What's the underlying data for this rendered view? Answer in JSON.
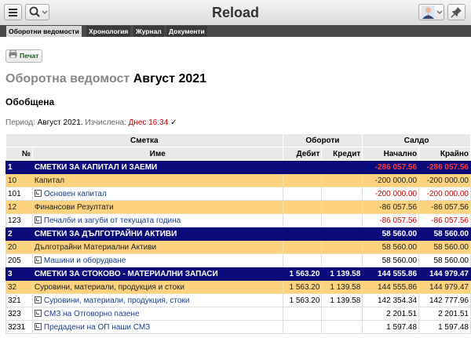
{
  "app": {
    "title": "Reload"
  },
  "tabs": [
    {
      "label": "Оборотни ведомости",
      "active": true
    },
    {
      "label": "Хронология",
      "active": false
    },
    {
      "label": "Журнал",
      "active": false
    },
    {
      "label": "Документи",
      "active": false
    }
  ],
  "toolbar": {
    "print_label": "Печат"
  },
  "report": {
    "title_prefix": "Оборотна ведомост",
    "title_period": "Август 2021",
    "subtitle": "Обобщена",
    "period_label": "Период:",
    "period_value": "Август 2021.",
    "computed_label": "Изчислена:",
    "computed_value": "Днес 16:34",
    "check_mark": "✓"
  },
  "table": {
    "headers": {
      "account": "Сметка",
      "turnover": "Обороти",
      "balance": "Салдо",
      "no": "№",
      "name": "Име",
      "debit": "Дебит",
      "credit": "Кредит",
      "opening": "Начално",
      "closing": "Крайно"
    },
    "rows": [
      {
        "kind": "class",
        "no": "1",
        "name": "СМЕТКИ ЗА КАПИТАЛ И ЗАЕМИ",
        "debit": "",
        "credit": "",
        "opening": "-286 057.56",
        "closing": "-286 057.56"
      },
      {
        "kind": "group",
        "no": "10",
        "name": "Капитал",
        "debit": "",
        "credit": "",
        "opening": "-200 000.00",
        "closing": "-200 000.00"
      },
      {
        "kind": "acc",
        "no": "101",
        "name": "Основен капитал",
        "debit": "",
        "credit": "",
        "opening": "-200 000.00",
        "closing": "-200 000.00"
      },
      {
        "kind": "group",
        "no": "12",
        "name": "Финансови Резултати",
        "debit": "",
        "credit": "",
        "opening": "-86 057.56",
        "closing": "-86 057.56"
      },
      {
        "kind": "acc",
        "no": "123",
        "name": "Печалби и загуби от текущата година",
        "debit": "",
        "credit": "",
        "opening": "-86 057.56",
        "closing": "-86 057.56"
      },
      {
        "kind": "class",
        "no": "2",
        "name": "СМЕТКИ ЗА ДЪЛГОТРАЙНИ АКТИВИ",
        "debit": "",
        "credit": "",
        "opening": "58 560.00",
        "closing": "58 560.00"
      },
      {
        "kind": "group",
        "no": "20",
        "name": "Дълготрайни Материални Активи",
        "debit": "",
        "credit": "",
        "opening": "58 560.00",
        "closing": "58 560.00"
      },
      {
        "kind": "acc",
        "no": "205",
        "name": "Машини и оборудване",
        "debit": "",
        "credit": "",
        "opening": "58 560.00",
        "closing": "58 560.00"
      },
      {
        "kind": "class",
        "no": "3",
        "name": "СМЕТКИ ЗА СТОКОВО - МАТЕРИАЛНИ ЗАПАСИ",
        "debit": "1 563.20",
        "credit": "1 139.58",
        "opening": "144 555.86",
        "closing": "144 979.47"
      },
      {
        "kind": "group",
        "no": "32",
        "name": "Суровини, материали, продукция и стоки",
        "debit": "1 563.20",
        "credit": "1 139.58",
        "opening": "144 555.86",
        "closing": "144 979.47"
      },
      {
        "kind": "acc",
        "no": "321",
        "name": "Суровини, материали, продукция, стоки",
        "debit": "1 563.20",
        "credit": "1 139.58",
        "opening": "142 354.34",
        "closing": "142 777.96"
      },
      {
        "kind": "acc",
        "no": "323",
        "name": "СМЗ на Отговорно пазене",
        "debit": "",
        "credit": "",
        "opening": "2 201.51",
        "closing": "2 201.51"
      },
      {
        "kind": "acc",
        "no": "3231",
        "name": "Предадени на ОП наши СМЗ",
        "debit": "",
        "credit": "",
        "opening": "1 597.48",
        "closing": "1 597.48"
      }
    ]
  }
}
